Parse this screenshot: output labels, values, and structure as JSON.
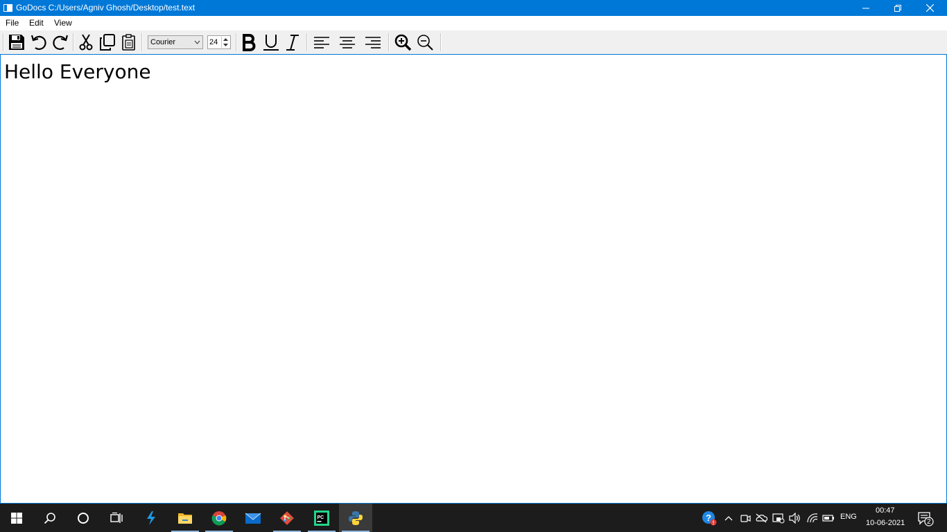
{
  "window": {
    "title": "GoDocs C:/Users/Agniv Ghosh/Desktop/test.text"
  },
  "menu": {
    "file": "File",
    "edit": "Edit",
    "view": "View"
  },
  "toolbar": {
    "font": "Courier",
    "size": "24"
  },
  "editor": {
    "text": "Hello Everyone"
  },
  "taskbar": {
    "language": "ENG",
    "time": "00:47",
    "date": "10-06-2021",
    "notification_count": "2"
  },
  "colors": {
    "titlebar": "#0078d7",
    "taskbar": "#1c1c1c",
    "toolbar": "#f0f0f0"
  },
  "icons": {
    "toolbar": [
      "save-icon",
      "undo-icon",
      "redo-icon",
      "cut-icon",
      "copy-icon",
      "paste-icon",
      "bold-icon",
      "underline-icon",
      "italic-icon",
      "align-left-icon",
      "align-center-icon",
      "align-right-icon",
      "zoom-in-icon",
      "zoom-out-icon"
    ],
    "taskbar": [
      "windows-start-icon",
      "search-icon",
      "cortana-icon",
      "task-view-icon",
      "visual-studio-icon",
      "file-explorer-icon",
      "chrome-icon",
      "mail-icon",
      "git-icon",
      "pycharm-icon",
      "python-icon"
    ]
  }
}
